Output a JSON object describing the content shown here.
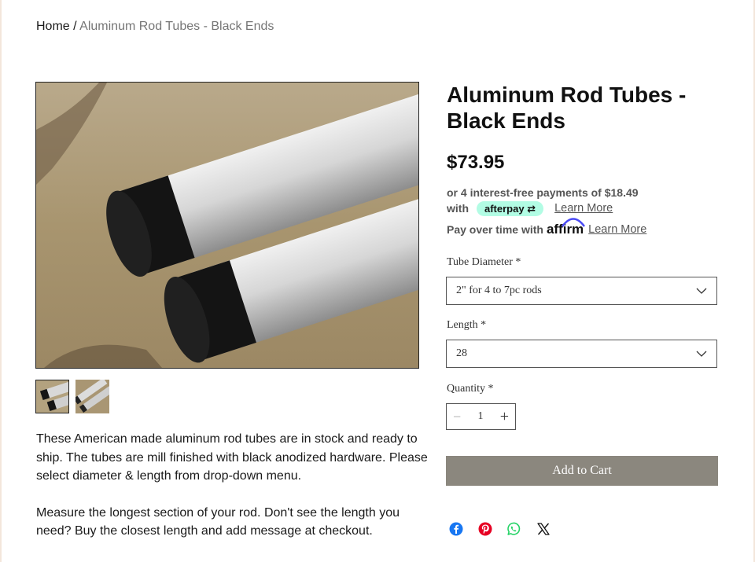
{
  "breadcrumb": {
    "home": "Home",
    "separator": "/",
    "current": "Aluminum Rod Tubes - Black Ends"
  },
  "product": {
    "title": "Aluminum Rod Tubes - Black Ends",
    "price": "$73.95",
    "description": [
      "These American made aluminum rod tubes are in stock and ready to ship. The tubes are mill finished with black anodized hardware. Please select diameter & length from drop-down menu.",
      "Measure the longest section of your rod. Don't see the length you need? Buy the closest length and add message at checkout."
    ]
  },
  "afterpay": {
    "line1": "or 4 interest-free payments of $18.49",
    "with": "with",
    "badge": "afterpay",
    "learn_more": "Learn More"
  },
  "affirm": {
    "text": "Pay over time with",
    "logo": "affirm",
    "learn_more": "Learn More"
  },
  "options": {
    "diameter": {
      "label": "Tube Diameter *",
      "selected": "2\" for 4 to 7pc rods"
    },
    "length": {
      "label": "Length *",
      "selected": "28"
    },
    "quantity": {
      "label": "Quantity *",
      "value": "1",
      "minus": "−",
      "plus": "+"
    }
  },
  "cart": {
    "add_label": "Add to Cart"
  },
  "colors": {
    "accent_button": "#8b877e",
    "afterpay_badge": "#b2fce4",
    "facebook": "#1877f2",
    "pinterest": "#e60023",
    "whatsapp": "#25d366",
    "x": "#111111"
  },
  "share_icons": [
    "facebook-icon",
    "pinterest-icon",
    "whatsapp-icon",
    "x-icon"
  ]
}
